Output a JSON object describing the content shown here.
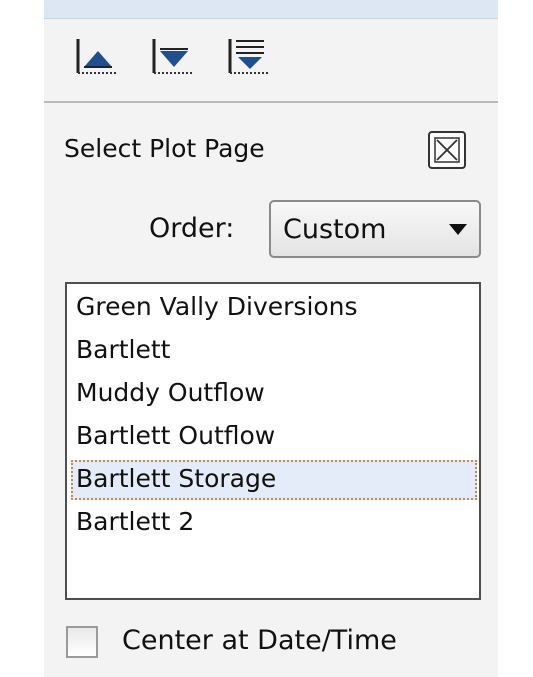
{
  "toolbar": {
    "buttons": [
      {
        "icon": "move-up-icon"
      },
      {
        "icon": "move-down-icon"
      },
      {
        "icon": "move-to-bottom-icon"
      }
    ]
  },
  "select_plot_page": {
    "label": "Select Plot Page"
  },
  "order": {
    "label": "Order:",
    "selected": "Custom"
  },
  "plot_pages": {
    "items": [
      {
        "label": "Green Vally Diversions",
        "selected": false
      },
      {
        "label": "Bartlett",
        "selected": false
      },
      {
        "label": "Muddy Outflow",
        "selected": false
      },
      {
        "label": "Bartlett Outflow",
        "selected": false
      },
      {
        "label": "Bartlett Storage",
        "selected": true
      },
      {
        "label": "Bartlett 2",
        "selected": false
      }
    ]
  },
  "center_at": {
    "label": "Center at Date/Time",
    "checked": false
  },
  "colors": {
    "panel_bg": "#f3f3f3",
    "icon_blue": "#1f4f8f",
    "selection_bg": "#e3ecf8",
    "selection_focus": "#c18a4f"
  }
}
